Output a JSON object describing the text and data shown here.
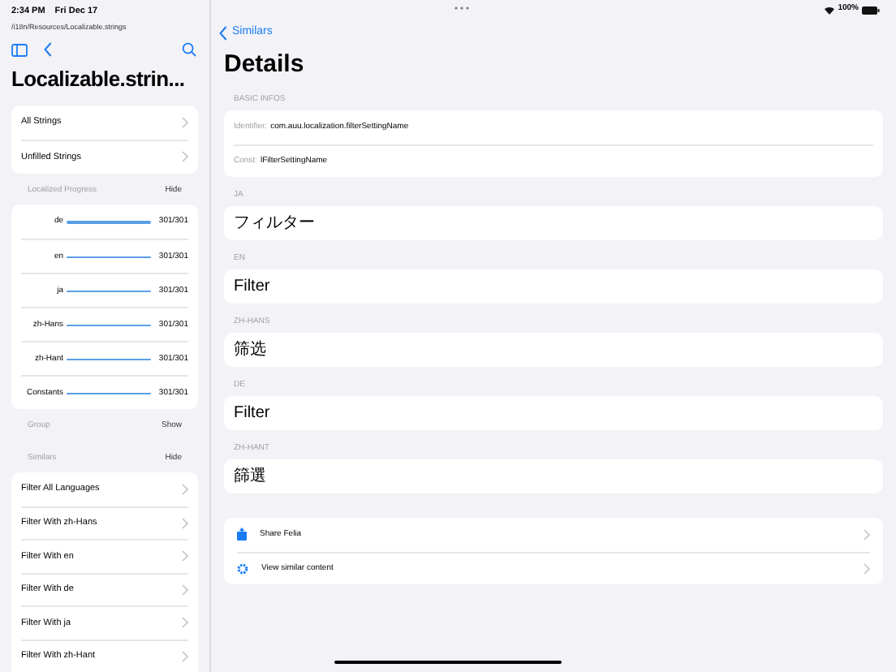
{
  "status_bar": {
    "time": "2:34 PM",
    "date": "Fri Dec 17",
    "battery": "100%"
  },
  "sidebar": {
    "path": "/i18n/Resources/Localizable.strings",
    "title": "Localizable.strin...",
    "nav_items": [
      {
        "label": "All Strings"
      },
      {
        "label": "Unfilled Strings"
      }
    ],
    "sections": [
      {
        "kind": "progress",
        "title": "Localized Progress",
        "toggle": "Hide",
        "rows": [
          {
            "language": "de",
            "level": 1,
            "reading": "301/301"
          },
          {
            "language": "en",
            "level": 1,
            "reading": "301/301"
          },
          {
            "language": "ja",
            "level": 1,
            "reading": "301/301"
          },
          {
            "language": "zh-Hans",
            "level": 1,
            "reading": "301/301"
          },
          {
            "language": "zh-Hant",
            "level": 1,
            "reading": "301/301"
          },
          {
            "language": "Constants",
            "level": 1,
            "reading": "301/301"
          }
        ]
      },
      {
        "kind": "collapsed",
        "title": "Group",
        "toggle": "Show"
      },
      {
        "kind": "links",
        "title": "Similars",
        "toggle": "Hide",
        "items": [
          {
            "label": "Filter All Languages"
          },
          {
            "label": "Filter With zh-Hans"
          },
          {
            "label": "Filter With en"
          },
          {
            "label": "Filter With de"
          },
          {
            "label": "Filter With ja"
          },
          {
            "label": "Filter With zh-Hant"
          }
        ]
      }
    ]
  },
  "detail": {
    "back_label": "Similars",
    "title": "Details",
    "basic_header": "BASIC INFOS",
    "basic_rows": [
      {
        "label": "Identifier:",
        "value": "com.auu.localization.filterSettingName"
      },
      {
        "label": "Const:",
        "value": "lFilterSettingName"
      }
    ],
    "translations": [
      {
        "header": "JA",
        "value": "フィルター"
      },
      {
        "header": "EN",
        "value": "Filter"
      },
      {
        "header": "ZH-HANS",
        "value": "筛选"
      },
      {
        "header": "DE",
        "value": "Filter"
      },
      {
        "header": "ZH-HANT",
        "value": "篩選"
      }
    ],
    "actions": [
      {
        "kind": "share",
        "label": "Share Felia"
      },
      {
        "kind": "similar",
        "label": "View similar content"
      }
    ]
  }
}
